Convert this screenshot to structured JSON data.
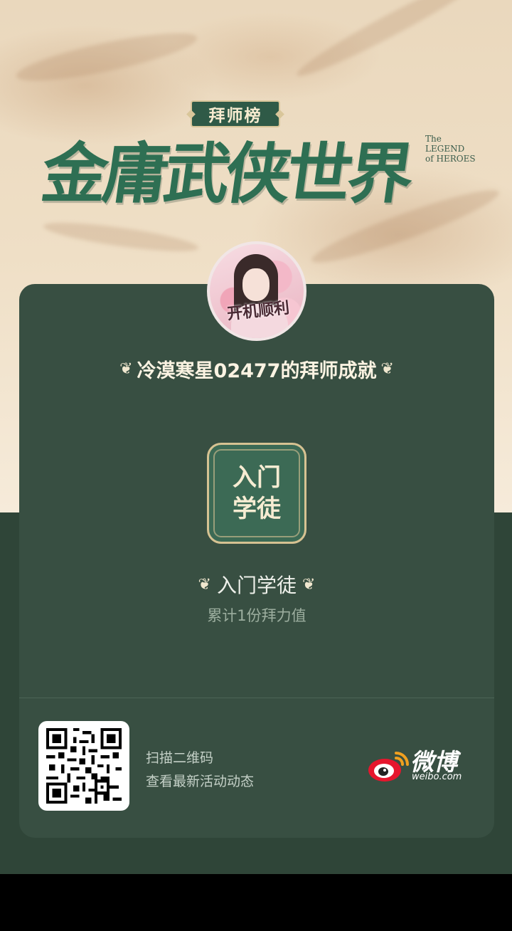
{
  "header": {
    "badge": "拜师榜",
    "game_title": "金庸武侠世界",
    "legend_lines": [
      "The",
      "LEGEND",
      "of HEROES"
    ]
  },
  "card": {
    "avatar_caption": "开机顺利",
    "achievement_title": "冷漠寒星02477的拜师成就",
    "emblem_line1": "入门",
    "emblem_line2": "学徒",
    "level_name": "入门学徒",
    "level_desc": "累计1份拜力值"
  },
  "footer": {
    "scan_line1": "扫描二维码",
    "scan_line2": "查看最新活动动态",
    "weibo_name": "微博",
    "weibo_domain": "weibo.com"
  },
  "colors": {
    "card_bg": "#384f42",
    "page_dark": "#2f4538",
    "title_green": "#2e6f53",
    "gold": "#d6c292"
  },
  "icons": [
    "laurel-icon",
    "qr-code-icon",
    "weibo-logo-icon"
  ]
}
